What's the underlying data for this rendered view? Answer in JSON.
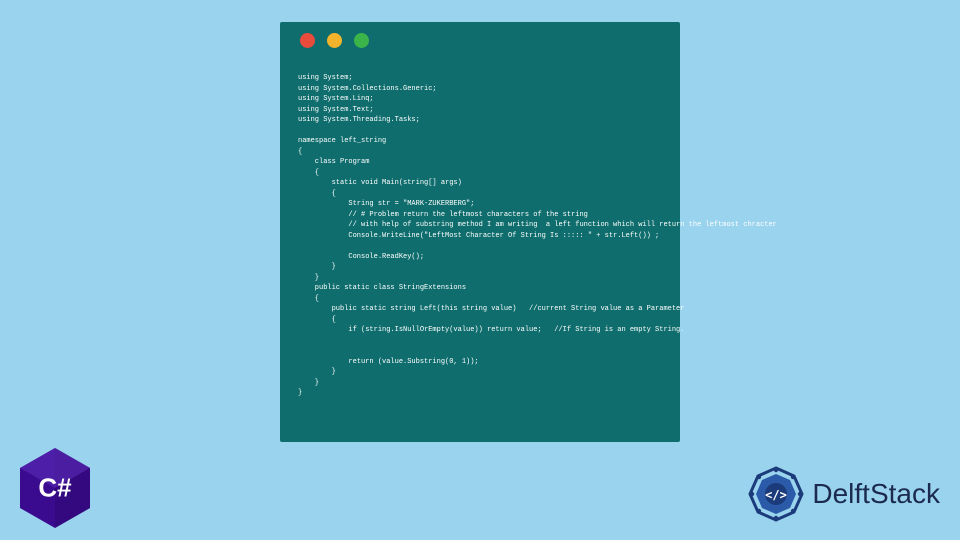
{
  "window": {
    "dots": {
      "red": "#e94b3c",
      "yellow": "#f3b32b",
      "green": "#3bb54a"
    }
  },
  "code": {
    "lines": [
      "using System;",
      "using System.Collections.Generic;",
      "using System.Linq;",
      "using System.Text;",
      "using System.Threading.Tasks;",
      "",
      "namespace left_string",
      "{",
      "    class Program",
      "    {",
      "        static void Main(string[] args)",
      "        {",
      "            String str = \"MARK-ZUKERBERG\";",
      "            // # Problem return the leftmost characters of the string",
      "            // with help of substring method I am writing  a left function which will return the leftmost chracter",
      "            Console.WriteLine(\"LeftMost Character Of String Is ::::: \" + str.Left()) ;",
      "",
      "            Console.ReadKey();",
      "        }",
      "    }",
      "    public static class StringExtensions",
      "    {",
      "        public static string Left(this string value)   //current String value as a Parameter",
      "        {",
      "            if (string.IsNullOrEmpty(value)) return value;   //If String is an empty String.",
      "",
      "",
      "            return (value.Substring(0, 1));",
      "        }",
      "    }",
      "}"
    ]
  },
  "csharp": {
    "label": "C#"
  },
  "delft": {
    "name": "DelftStack"
  }
}
